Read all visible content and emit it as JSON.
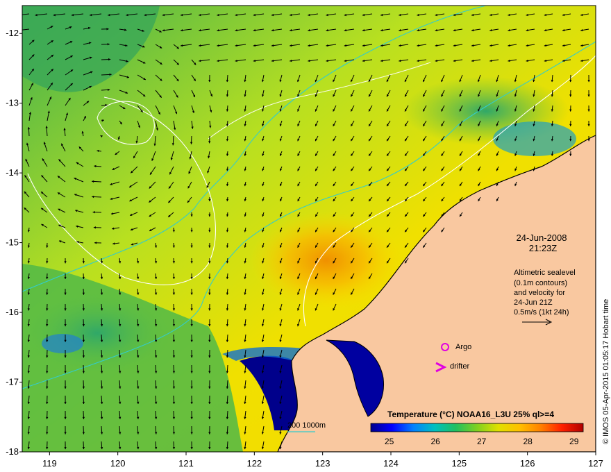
{
  "map": {
    "lon_range": [
      118.6,
      127.0
    ],
    "lat_range": [
      -18.0,
      -11.6
    ],
    "x_ticks": [
      "119",
      "120",
      "121",
      "122",
      "123",
      "124",
      "125",
      "126",
      "127"
    ],
    "y_ticks": [
      "-12",
      "-13",
      "-14",
      "-15",
      "-16",
      "-17",
      "-18"
    ],
    "colors": {
      "land": "#f9c8a0",
      "coast_line": "#000000",
      "contour_color": "#ffffff",
      "bathy_color": "#33cccc",
      "argo_color": "#e000e0"
    }
  },
  "annotations": {
    "date": "24-Jun-2008",
    "time": "21:23Z",
    "altimetry_line1": "Altimetric sealevel",
    "altimetry_line2": "(0.1m contours)",
    "altimetry_line3": "and velocity for",
    "altimetry_line4": "24-Jun 21Z",
    "scale_arrow_label": "0.5m/s (1kt 24h)",
    "argo_label": "Argo",
    "drifter_label": "drifter",
    "bathy_label": "200  1000m",
    "credit": "© IMOS 05-Apr-2015 01:05:17 Hobart time"
  },
  "colorbar": {
    "title": "Temperature (°C) NOAA16_L3U 25% ql>=4",
    "min": 24.6,
    "max": 29.2,
    "ticks": [
      "25",
      "26",
      "27",
      "28",
      "29"
    ],
    "colors": [
      "#00008b",
      "#0000ff",
      "#0080ff",
      "#00c0c0",
      "#20c060",
      "#80d020",
      "#e0e000",
      "#ffc000",
      "#ff8000",
      "#ff2000",
      "#b00000"
    ]
  }
}
